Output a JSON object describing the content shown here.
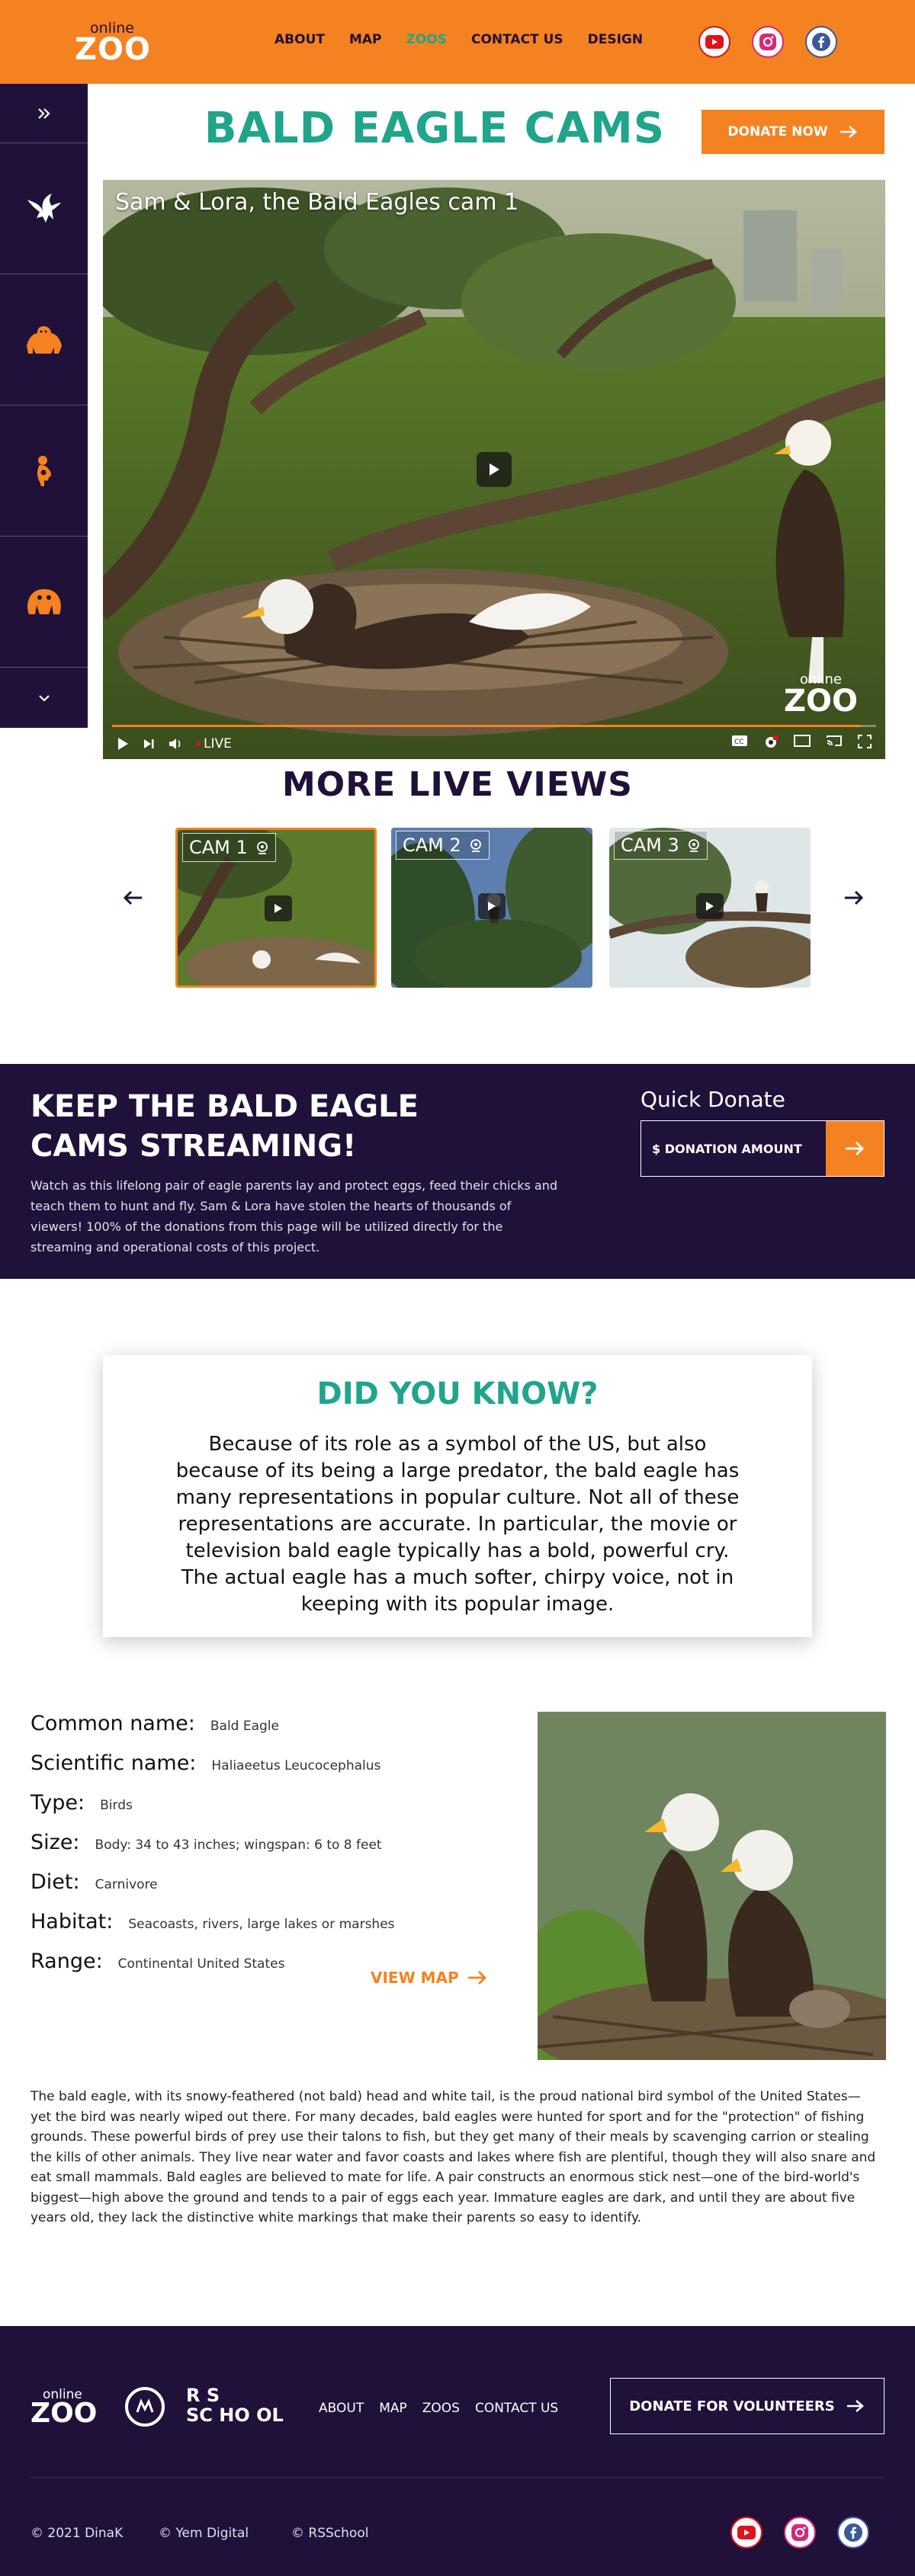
{
  "header": {
    "logo_small": "online",
    "logo_big": "ZOO",
    "nav": [
      {
        "label": "ABOUT"
      },
      {
        "label": "MAP"
      },
      {
        "label": "ZOOS"
      },
      {
        "label": "CONTACT US"
      },
      {
        "label": "DESIGN"
      }
    ],
    "active_nav": "ZOOS",
    "socials": [
      "youtube-icon",
      "instagram-icon",
      "facebook-icon"
    ]
  },
  "sidebar": {
    "items": [
      "double-chevron-right-icon",
      "eagle-icon",
      "gorilla-icon",
      "monkey-icon",
      "panda-icon",
      "chevron-down-icon"
    ]
  },
  "hero": {
    "title": "BALD EAGLE CAMS",
    "donate_label": "DONATE NOW"
  },
  "video": {
    "caption": "Sam & Lora, the Bald Eagles cam 1",
    "logo_small": "online",
    "logo_big": "ZOO",
    "live_label": "LIVE",
    "progress": 0.98
  },
  "live_views": {
    "title": "MORE LIVE VIEWS",
    "cams": [
      {
        "label": "CAM 1",
        "selected": true
      },
      {
        "label": "CAM 2",
        "selected": false
      },
      {
        "label": "CAM 3",
        "selected": false
      }
    ]
  },
  "streaming": {
    "title": "KEEP THE BALD EAGLE CAMS STREAMING!",
    "text": "Watch as this lifelong pair of eagle parents lay and protect eggs, feed their chicks and teach them to hunt and fly. Sam & Lora have stolen the hearts of thousands of viewers! 100% of the donations from this page will be utilized directly for the streaming and operational costs of this project.",
    "quick_label": "Quick Donate",
    "amount_placeholder": "$ DONATION AMOUNT"
  },
  "did_you_know": {
    "title": "DID YOU KNOW?",
    "text": "Because of its role as a symbol of the US, but also because of its being a large predator, the bald eagle has many representations in popular culture. Not all of these representations are accurate. In particular, the movie or television bald eagle typically has a bold, powerful cry. The actual eagle has a much softer, chirpy voice, not in keeping with its popular image."
  },
  "facts": [
    {
      "label": "Common name:",
      "value": "Bald Eagle"
    },
    {
      "label": "Scientific name:",
      "value": "Haliaeetus Leucocephalus"
    },
    {
      "label": "Type:",
      "value": "Birds"
    },
    {
      "label": "Size:",
      "value": "Body: 34 to 43 inches; wingspan: 6 to 8 feet"
    },
    {
      "label": "Diet:",
      "value": "Carnivore"
    },
    {
      "label": "Habitat:",
      "value": "Seacoasts, rivers, large lakes or marshes"
    },
    {
      "label": "Range:",
      "value": "Continental United States"
    }
  ],
  "view_map_label": "VIEW MAP",
  "description": "The bald eagle, with its snowy-feathered (not bald) head and white tail, is the proud national bird symbol of the United States—yet the bird was nearly wiped out there. For many decades, bald eagles were hunted for sport and for the \"protection\" of fishing grounds.  These powerful birds of prey use their talons to fish, but they get many of their meals by scavenging carrion or stealing the kills of other animals. They live near water and favor coasts and lakes where fish are plentiful, though they will also snare and eat small mammals. Bald eagles are believed to mate for life. A pair constructs an enormous stick nest—one of the bird-world's biggest—high above the ground and tends to a pair of eggs each year. Immature eagles are dark, and until they are about five years old, they lack the distinctive white markings that make their parents so easy to identify.",
  "footer": {
    "logo_small": "online",
    "logo_big": "ZOO",
    "rss_line1": "R S",
    "rss_line2": "SC HO OL",
    "nav": [
      {
        "label": "ABOUT"
      },
      {
        "label": "MAP"
      },
      {
        "label": "ZOOS"
      },
      {
        "label": "CONTACT US"
      }
    ],
    "donate_label": "DONATE FOR VOLUNTEERS",
    "copy1": "© 2021 DinaK",
    "copy2": "© Yem Digital",
    "copy3": "© RSSchool"
  },
  "colors": {
    "accent": "#f58220",
    "dark": "#20113a",
    "teal": "#20a58c"
  }
}
